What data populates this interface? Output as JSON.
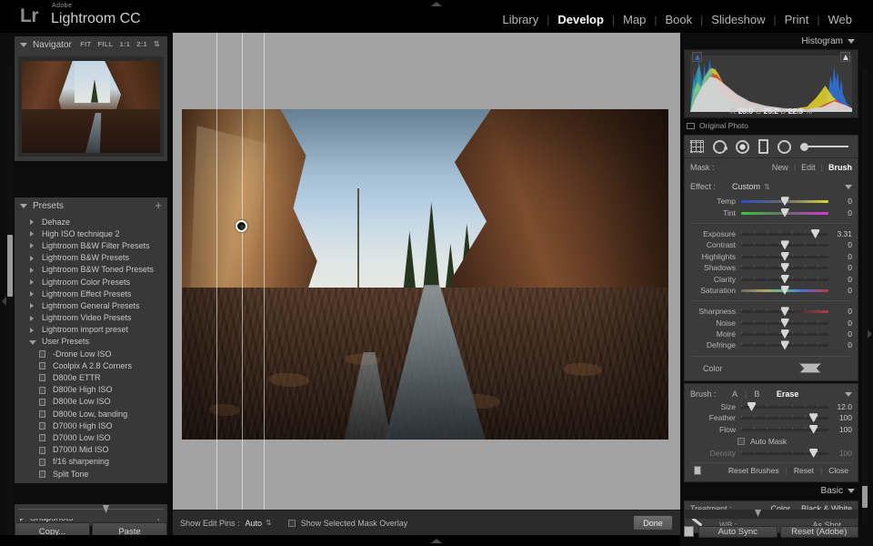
{
  "app": {
    "logo_mark": "Lr",
    "brand_line1": "Adobe",
    "brand_line2": "Lightroom CC"
  },
  "modules": [
    {
      "label": "Library",
      "active": false
    },
    {
      "label": "Develop",
      "active": true
    },
    {
      "label": "Map",
      "active": false
    },
    {
      "label": "Book",
      "active": false
    },
    {
      "label": "Slideshow",
      "active": false
    },
    {
      "label": "Print",
      "active": false
    },
    {
      "label": "Web",
      "active": false
    }
  ],
  "left": {
    "navigator": {
      "title": "Navigator",
      "zoom_options": [
        "FIT",
        "FILL",
        "1:1",
        "2:1"
      ]
    },
    "presets": {
      "title": "Presets",
      "add_label": "+",
      "items": [
        {
          "label": "Dehaze",
          "type": "folder",
          "expanded": false
        },
        {
          "label": "High ISO technique 2",
          "type": "folder",
          "expanded": false
        },
        {
          "label": "Lightroom B&W Filter Presets",
          "type": "folder",
          "expanded": false
        },
        {
          "label": "Lightroom B&W Presets",
          "type": "folder",
          "expanded": false
        },
        {
          "label": "Lightroom B&W Toned Presets",
          "type": "folder",
          "expanded": false
        },
        {
          "label": "Lightroom Color Presets",
          "type": "folder",
          "expanded": false
        },
        {
          "label": "Lightroom Effect Presets",
          "type": "folder",
          "expanded": false
        },
        {
          "label": "Lightroom General Presets",
          "type": "folder",
          "expanded": false
        },
        {
          "label": "Lightroom Video Presets",
          "type": "folder",
          "expanded": false
        },
        {
          "label": "Lightroom import preset",
          "type": "folder",
          "expanded": false
        },
        {
          "label": "User Presets",
          "type": "folder",
          "expanded": true
        },
        {
          "label": "-Drone Low ISO",
          "type": "preset"
        },
        {
          "label": "Coolpix A 2.8 Corners",
          "type": "preset"
        },
        {
          "label": "D800e ETTR",
          "type": "preset"
        },
        {
          "label": "D800e High ISO",
          "type": "preset"
        },
        {
          "label": "D800e Low ISO",
          "type": "preset"
        },
        {
          "label": "D800e Low, banding",
          "type": "preset"
        },
        {
          "label": "D7000 High ISO",
          "type": "preset"
        },
        {
          "label": "D7000 Low ISO",
          "type": "preset"
        },
        {
          "label": "D7000 Mid ISO",
          "type": "preset"
        },
        {
          "label": "f/16 sharpening",
          "type": "preset"
        },
        {
          "label": "Split Tone",
          "type": "preset"
        }
      ]
    },
    "snapshots": {
      "title": "Snapshots",
      "add_label": "+"
    },
    "copy_label": "Copy...",
    "paste_label": "Paste"
  },
  "toolbar": {
    "show_edit_pins_label": "Show Edit Pins :",
    "show_edit_pins_value": "Auto",
    "mask_overlay_label": "Show Selected Mask Overlay",
    "mask_overlay_checked": false,
    "done_label": "Done"
  },
  "right": {
    "histogram": {
      "title": "Histogram",
      "readout": [
        {
          "channel": "R",
          "value": "28.0"
        },
        {
          "channel": "G",
          "value": "25.2"
        },
        {
          "channel": "B",
          "value": "22.3"
        }
      ],
      "unit": "%",
      "original_photo_label": "Original Photo"
    },
    "tools": [
      {
        "name": "crop-overlay"
      },
      {
        "name": "spot-removal"
      },
      {
        "name": "red-eye-correction"
      },
      {
        "name": "graduated-filter"
      },
      {
        "name": "radial-filter"
      },
      {
        "name": "adjustment-brush"
      }
    ],
    "mask": {
      "label": "Mask :",
      "options": [
        {
          "label": "New",
          "active": false
        },
        {
          "label": "Edit",
          "active": false
        },
        {
          "label": "Brush",
          "active": true
        }
      ]
    },
    "effect": {
      "label": "Effect :",
      "value": "Custom"
    },
    "color_sliders": [
      {
        "label": "Temp",
        "value": "0",
        "pos": 50,
        "grad": "grad-temp"
      },
      {
        "label": "Tint",
        "value": "0",
        "pos": 50,
        "grad": "grad-tint"
      }
    ],
    "tone_sliders": [
      {
        "label": "Exposure",
        "value": "3.31",
        "pos": 85,
        "grad": ""
      },
      {
        "label": "Contrast",
        "value": "0",
        "pos": 50,
        "grad": ""
      },
      {
        "label": "Highlights",
        "value": "0",
        "pos": 50,
        "grad": ""
      },
      {
        "label": "Shadows",
        "value": "0",
        "pos": 50,
        "grad": ""
      },
      {
        "label": "Clarity",
        "value": "0",
        "pos": 50,
        "grad": ""
      },
      {
        "label": "Saturation",
        "value": "0",
        "pos": 50,
        "grad": "grad-sat"
      }
    ],
    "detail_sliders": [
      {
        "label": "Sharpness",
        "value": "0",
        "pos": 50,
        "grad": "grad-sharp"
      },
      {
        "label": "Noise",
        "value": "0",
        "pos": 50,
        "grad": ""
      },
      {
        "label": "Moiré",
        "value": "0",
        "pos": 50,
        "grad": ""
      },
      {
        "label": "Defringe",
        "value": "0",
        "pos": 50,
        "grad": ""
      }
    ],
    "color": {
      "label": "Color"
    },
    "brush": {
      "label": "Brush :",
      "options": [
        {
          "label": "A",
          "active": false
        },
        {
          "label": "B",
          "active": false
        },
        {
          "label": "Erase",
          "active": true
        }
      ],
      "sliders": [
        {
          "label": "Size",
          "value": "12.0",
          "pos": 12,
          "dim": false
        },
        {
          "label": "Feather",
          "value": "100",
          "pos": 83,
          "dim": false
        },
        {
          "label": "Flow",
          "value": "100",
          "pos": 83,
          "dim": false
        }
      ],
      "auto_mask_label": "Auto Mask",
      "auto_mask_checked": false,
      "density": {
        "label": "Density",
        "value": "100",
        "pos": 83,
        "dim": true
      },
      "footer": [
        {
          "label": "Reset Brushes"
        },
        {
          "label": "Reset"
        },
        {
          "label": "Close"
        }
      ]
    },
    "basic": {
      "title": "Basic",
      "treatment_label": "Treatment :",
      "treatment_options": [
        {
          "label": "Color"
        },
        {
          "label": "Black & White"
        }
      ],
      "wb_label": "WB :",
      "wb_value": "As Shot"
    },
    "auto_sync_label": "Auto Sync",
    "reset_label": "Reset (Adobe)"
  },
  "canvas": {
    "brush_pin_label": "brush-edit-pin",
    "stroke_guides": 3
  },
  "colors": {
    "panel_bg": "#383838",
    "right_panel_bg": "#3b3b3b",
    "canvas_bg": "#a3a3a3",
    "chrome": "#0c0c0c",
    "accent_text": "#ffffff"
  }
}
